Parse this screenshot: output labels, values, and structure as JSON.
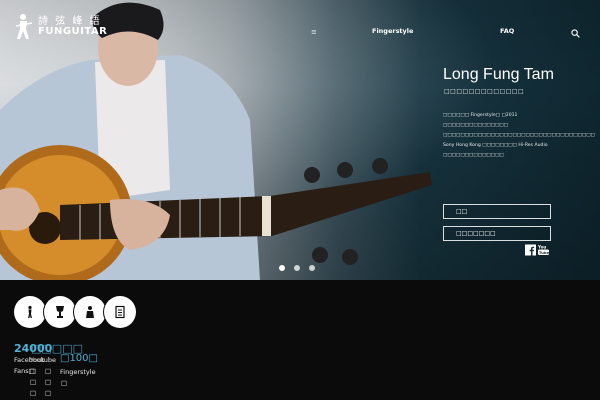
{
  "header": {
    "logo": {
      "cn": "詩 弦 峰 語",
      "en": "FUNGUITAR"
    },
    "lang_label": "≡",
    "nav": [
      "Fingerstyle",
      "FAQ"
    ],
    "search_icon": "search-icon"
  },
  "hero": {
    "name": "Long Fung Tam",
    "subtitle": "□□□□□□□□□□□□□",
    "bio": "□□□□□□ Fingerstyle□ □2011 □□□□□□□□□□□□□□□ □□□□□□□□□□□□□□□□□□□□□□□□□□□□□□□□□□□ Sony Hong Kong □□□□□□□□ Hi-Res Audio □□□□□□□□□□□□□□",
    "buttons": [
      "□□",
      "□□□□□□□"
    ],
    "social_icons": [
      "facebook-icon",
      "youtube-icon"
    ],
    "slides": 3,
    "active_slide": 0
  },
  "stats": {
    "badges": [
      "guitarist-icon",
      "award-icon",
      "figure-icon",
      "document-icon"
    ],
    "num_1": "24000",
    "num_2": "□□□□□",
    "num_3": "□100□",
    "label_1": "Facebook Fans□",
    "label_2": "Youtube",
    "label_3": "Fingerstyle",
    "col_1": "□ □ □",
    "col_2": "□ □ □",
    "col_3": "□"
  },
  "colors": {
    "accent": "#4fb2d8",
    "bg_dark": "#0b0b0c"
  }
}
